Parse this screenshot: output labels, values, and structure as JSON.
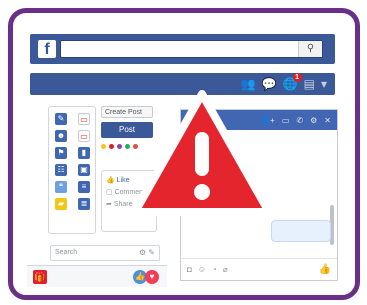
{
  "header": {
    "logo_letter": "f",
    "search_placeholder": "",
    "search_icon": "search-icon"
  },
  "navbar": {
    "icons": [
      "friends-icon",
      "messages-icon",
      "globe-notifications-icon",
      "menu-icon",
      "dropdown-arrow-icon"
    ],
    "notification_count": "1"
  },
  "compose": {
    "label": "Create Post",
    "button_label": "Post",
    "dot_colors": [
      "#f5c518",
      "#e02020",
      "#8e44ad",
      "#27ae60",
      "#e74c3c"
    ]
  },
  "post": {
    "like_label": "Like",
    "comment_label": "Comment",
    "share_label": "Share"
  },
  "chat": {
    "search_placeholder": "Search",
    "header_icons": [
      "add-friend-icon",
      "video-icon",
      "phone-icon",
      "settings-icon",
      "close-icon"
    ],
    "footer_icons": [
      "camera-icon",
      "emoji-icon",
      "sticker-icon",
      "attach-icon"
    ]
  },
  "colors": {
    "frame": "#6a2f86",
    "facebook_blue": "#3b5998",
    "warning_red": "#e4252d"
  }
}
